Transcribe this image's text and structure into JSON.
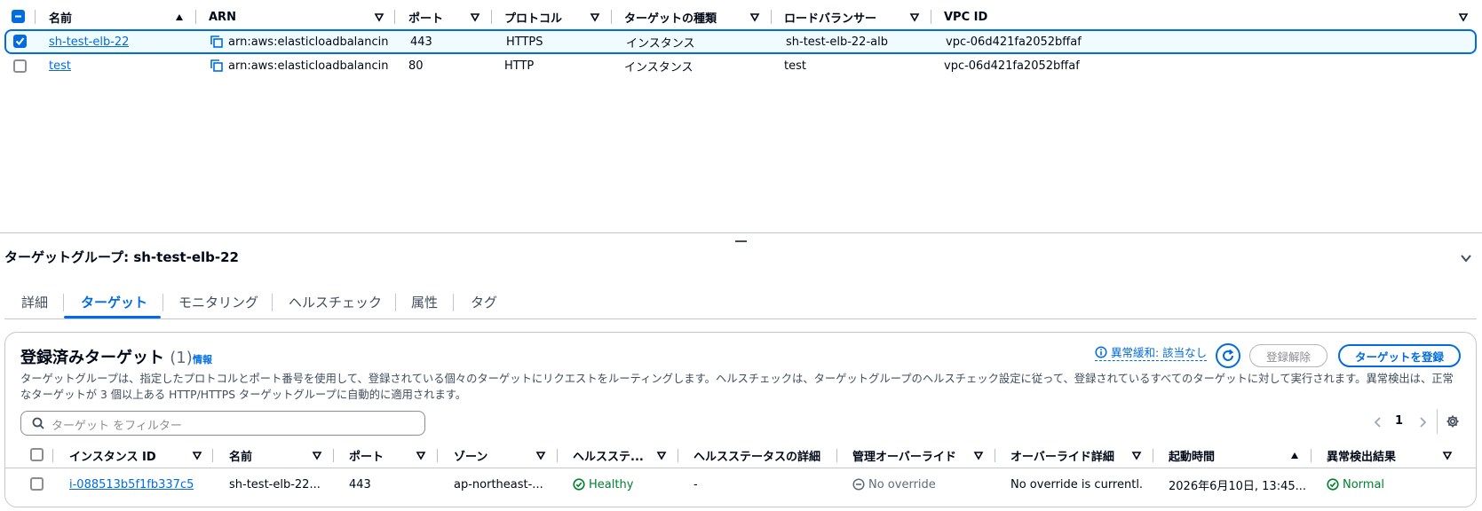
{
  "target_groups_table": {
    "columns": [
      "名前",
      "ARN",
      "ポート",
      "プロトコル",
      "ターゲットの種類",
      "ロードバランサー",
      "VPC ID"
    ],
    "rows": [
      {
        "name": "sh-test-elb-22",
        "arn": "arn:aws:elasticloadbalancin...",
        "port": "443",
        "protocol": "HTTPS",
        "target_type": "インスタンス",
        "load_balancer": "sh-test-elb-22-alb",
        "vpc_id": "vpc-06d421fa2052bffaf",
        "selected": true
      },
      {
        "name": "test",
        "arn": "arn:aws:elasticloadbalancin...",
        "port": "80",
        "protocol": "HTTP",
        "target_type": "インスタンス",
        "load_balancer": "test",
        "vpc_id": "vpc-06d421fa2052bffaf",
        "selected": false
      }
    ]
  },
  "detail": {
    "title": "ターゲットグループ: sh-test-elb-22",
    "tabs": [
      "詳細",
      "ターゲット",
      "モニタリング",
      "ヘルスチェック",
      "属性",
      "タグ"
    ],
    "active_tab": "ターゲット"
  },
  "registered_targets": {
    "title": "登録済みターゲット",
    "count": "(1)",
    "info": "情報",
    "description": "ターゲットグループは、指定したプロトコルとポート番号を使用して、登録されている個々のターゲットにリクエストをルーティングします。ヘルスチェックは、ターゲットグループのヘルスチェック設定に従って、登録されているすべてのターゲットに対して実行されます。異常検出は、正常なターゲットが 3 個以上ある HTTP/HTTPS ターゲットグループに自動的に適用されます。",
    "anomaly_mitigation": "異常緩和: 該当なし",
    "deregister_label": "登録解除",
    "register_label": "ターゲットを登録",
    "filter_placeholder": "ターゲット をフィルター",
    "page": "1",
    "columns": [
      "インスタンス ID",
      "名前",
      "ポート",
      "ゾーン",
      "ヘルスステ...",
      "ヘルスステータスの詳細",
      "管理オーバーライド",
      "オーバーライド詳細",
      "起動時間",
      "異常検出結果"
    ],
    "rows": [
      {
        "instance_id": "i-088513b5f1fb337c5",
        "name": "sh-test-elb-22...",
        "port": "443",
        "zone": "ap-northeast-...",
        "health": "Healthy",
        "health_detail": "-",
        "admin_override": "No override",
        "override_detail": "No override is currentl...",
        "launch_time": "2026年6月10日, 13:45...",
        "anomaly_result": "Normal"
      }
    ]
  },
  "colors": {
    "accent": "#006ce0",
    "healthy": "#00802f",
    "text": "#000716",
    "muted": "#5f6b7a"
  }
}
